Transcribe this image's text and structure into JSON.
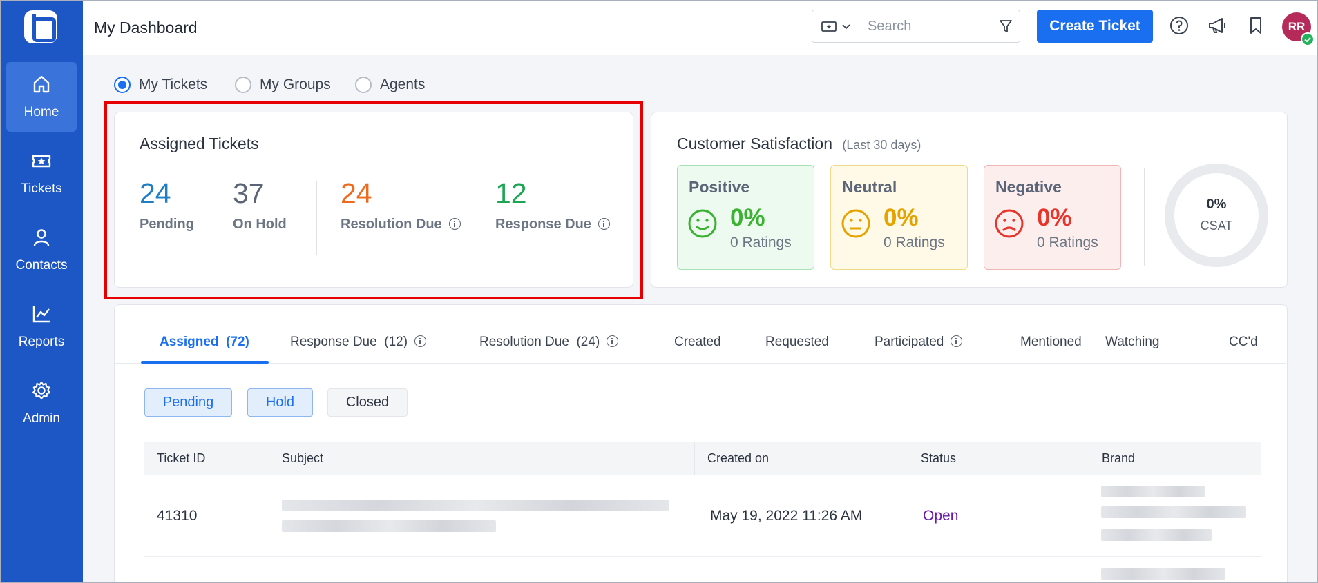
{
  "sidebar": {
    "items": [
      {
        "label": "Home",
        "icon": "home-icon",
        "active": true
      },
      {
        "label": "Tickets",
        "icon": "ticket-icon"
      },
      {
        "label": "Contacts",
        "icon": "contacts-icon"
      },
      {
        "label": "Reports",
        "icon": "reports-icon"
      },
      {
        "label": "Admin",
        "icon": "gear-icon"
      }
    ]
  },
  "header": {
    "title": "My Dashboard",
    "search_placeholder": "Search",
    "create_label": "Create Ticket",
    "avatar_initials": "RR"
  },
  "view_options": {
    "selected": "My Tickets",
    "options": [
      "My Tickets",
      "My Groups",
      "Agents"
    ]
  },
  "assigned": {
    "title": "Assigned Tickets",
    "stats": [
      {
        "value": "24",
        "label": "Pending",
        "color": "#1f7fc4"
      },
      {
        "value": "37",
        "label": "On Hold",
        "color": "#5b6577"
      },
      {
        "value": "24",
        "label": "Resolution Due",
        "color": "#ee6a1f"
      },
      {
        "value": "12",
        "label": "Response Due",
        "color": "#1aa653"
      }
    ]
  },
  "satisfaction": {
    "title": "Customer Satisfaction",
    "period": "(Last 30 days)",
    "boxes": [
      {
        "name": "Positive",
        "pct": "0%",
        "ratings": "0 Ratings",
        "color": "#3cb232",
        "bg": "#ecfaef",
        "border": "#a6e2b2"
      },
      {
        "name": "Neutral",
        "pct": "0%",
        "ratings": "0 Ratings",
        "color": "#e5a300",
        "bg": "#fff9e8",
        "border": "#f1d98a"
      },
      {
        "name": "Negative",
        "pct": "0%",
        "ratings": "0 Ratings",
        "color": "#e8352b",
        "bg": "#fdeeee",
        "border": "#f1b5b5"
      }
    ],
    "csat_value": "0%",
    "csat_label": "CSAT"
  },
  "tabs": [
    {
      "label": "Assigned",
      "count": "(72)",
      "active": true
    },
    {
      "label": "Response Due",
      "count": "(12)",
      "info": true
    },
    {
      "label": "Resolution Due",
      "count": "(24)",
      "info": true
    },
    {
      "label": "Created"
    },
    {
      "label": "Requested"
    },
    {
      "label": "Participated",
      "info": true
    },
    {
      "label": "Mentioned"
    },
    {
      "label": "Watching"
    },
    {
      "label": "CC'd"
    }
  ],
  "filters": [
    {
      "label": "Pending",
      "on": true
    },
    {
      "label": "Hold",
      "on": true
    },
    {
      "label": "Closed",
      "on": false
    }
  ],
  "table": {
    "columns": [
      "Ticket ID",
      "Subject",
      "Created on",
      "Status",
      "Brand"
    ],
    "rows": [
      {
        "id": "41310",
        "created": "May 19, 2022 11:26 AM",
        "status": "Open",
        "status_color": "#6a1aa8"
      }
    ]
  }
}
